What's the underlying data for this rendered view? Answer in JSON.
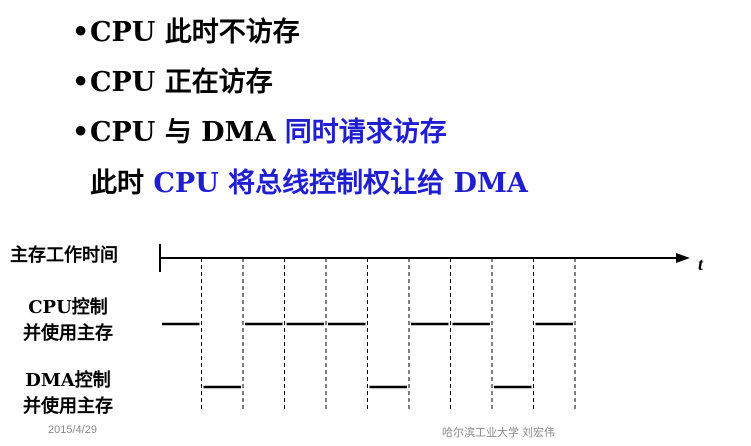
{
  "bullets": [
    {
      "dot": "•",
      "parts": [
        "CPU 此时不访存"
      ]
    },
    {
      "dot": "•",
      "parts": [
        "CPU 正在访存"
      ]
    },
    {
      "dot": "•",
      "parts": [
        "CPU 与 DMA ",
        "同时请求访存"
      ]
    },
    {
      "dot": "",
      "parts": [
        "此时 ",
        "CPU 将总线控制权让给 DMA"
      ]
    }
  ],
  "labels": {
    "main_time": "主存工作时间",
    "cpu_line1": "CPU控制",
    "cpu_line2": "并使用主存",
    "dma_line1": "DMA控制",
    "dma_line2": "并使用主存",
    "axis_t": "t"
  },
  "timing": {
    "slots": 10,
    "cpu_busy": [
      1,
      0,
      1,
      1,
      1,
      0,
      1,
      1,
      0,
      1
    ],
    "dma_busy": [
      0,
      1,
      0,
      0,
      0,
      1,
      0,
      0,
      1,
      0
    ]
  },
  "footer": {
    "date": "2015/4/29",
    "author": "哈尔滨工业大学 刘宏伟"
  },
  "colors": {
    "highlight": "#1f1fd0",
    "footer": "#8a8a8a"
  }
}
